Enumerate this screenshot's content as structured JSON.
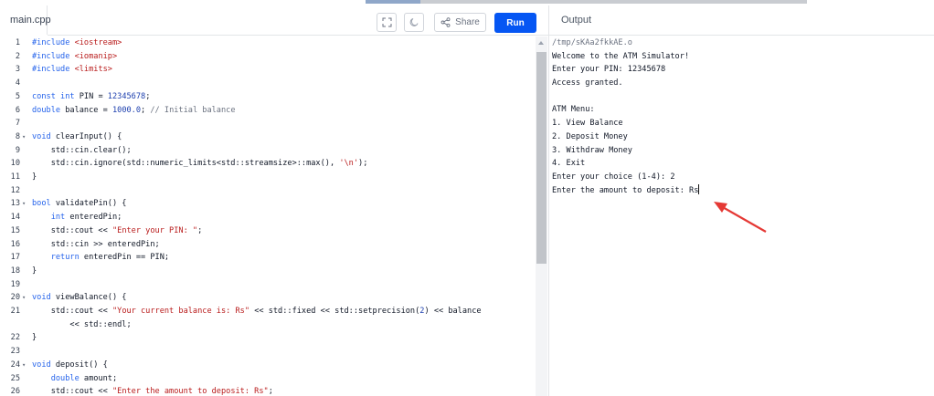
{
  "header": {
    "file_tab": "main.cpp",
    "share_label": "Share",
    "run_label": "Run",
    "output_label": "Output",
    "icons": [
      "fullscreen-icon",
      "theme-moon-icon",
      "share-icon"
    ]
  },
  "colors": {
    "run_button": "#0556f3",
    "keyword": "#2563eb",
    "string": "#b91c1c",
    "comment": "#6b7280",
    "annotation_arrow": "#e53935"
  },
  "editor": {
    "lines": [
      {
        "n": "1",
        "fold": "",
        "tokens": [
          {
            "t": "#include ",
            "c": "kw"
          },
          {
            "t": "<iostream>",
            "c": "inc"
          }
        ]
      },
      {
        "n": "2",
        "fold": "",
        "tokens": [
          {
            "t": "#include ",
            "c": "kw"
          },
          {
            "t": "<iomanip>",
            "c": "inc"
          }
        ]
      },
      {
        "n": "3",
        "fold": "",
        "tokens": [
          {
            "t": "#include ",
            "c": "kw"
          },
          {
            "t": "<limits>",
            "c": "inc"
          }
        ]
      },
      {
        "n": "4",
        "fold": "",
        "tokens": []
      },
      {
        "n": "5",
        "fold": "",
        "tokens": [
          {
            "t": "const int ",
            "c": "kw"
          },
          {
            "t": "PIN = ",
            "c": "pl"
          },
          {
            "t": "12345678",
            "c": "num"
          },
          {
            "t": ";",
            "c": "pl"
          }
        ]
      },
      {
        "n": "6",
        "fold": "",
        "tokens": [
          {
            "t": "double ",
            "c": "kw"
          },
          {
            "t": "balance = ",
            "c": "pl"
          },
          {
            "t": "1000.0",
            "c": "num"
          },
          {
            "t": "; ",
            "c": "pl"
          },
          {
            "t": "// Initial balance",
            "c": "cmt"
          }
        ]
      },
      {
        "n": "7",
        "fold": "",
        "tokens": []
      },
      {
        "n": "8",
        "fold": "▾",
        "tokens": [
          {
            "t": "void ",
            "c": "kw"
          },
          {
            "t": "clearInput() {",
            "c": "pl"
          }
        ]
      },
      {
        "n": "9",
        "fold": "",
        "tokens": [
          {
            "t": "    std::cin.clear();",
            "c": "pl"
          }
        ]
      },
      {
        "n": "10",
        "fold": "",
        "tokens": [
          {
            "t": "    std::cin.ignore(std::numeric_limits<std::streamsize>::max(), ",
            "c": "pl"
          },
          {
            "t": "'\\n'",
            "c": "str"
          },
          {
            "t": ");",
            "c": "pl"
          }
        ]
      },
      {
        "n": "11",
        "fold": "",
        "tokens": [
          {
            "t": "}",
            "c": "pl"
          }
        ]
      },
      {
        "n": "12",
        "fold": "",
        "tokens": []
      },
      {
        "n": "13",
        "fold": "▾",
        "tokens": [
          {
            "t": "bool ",
            "c": "kw"
          },
          {
            "t": "validatePin() {",
            "c": "pl"
          }
        ]
      },
      {
        "n": "14",
        "fold": "",
        "tokens": [
          {
            "t": "    ",
            "c": "pl"
          },
          {
            "t": "int ",
            "c": "kw"
          },
          {
            "t": "enteredPin;",
            "c": "pl"
          }
        ]
      },
      {
        "n": "15",
        "fold": "",
        "tokens": [
          {
            "t": "    std::cout << ",
            "c": "pl"
          },
          {
            "t": "\"Enter your PIN: \"",
            "c": "str"
          },
          {
            "t": ";",
            "c": "pl"
          }
        ]
      },
      {
        "n": "16",
        "fold": "",
        "tokens": [
          {
            "t": "    std::cin >> enteredPin;",
            "c": "pl"
          }
        ]
      },
      {
        "n": "17",
        "fold": "",
        "tokens": [
          {
            "t": "    ",
            "c": "pl"
          },
          {
            "t": "return ",
            "c": "kw"
          },
          {
            "t": "enteredPin == PIN;",
            "c": "pl"
          }
        ]
      },
      {
        "n": "18",
        "fold": "",
        "tokens": [
          {
            "t": "}",
            "c": "pl"
          }
        ]
      },
      {
        "n": "19",
        "fold": "",
        "tokens": []
      },
      {
        "n": "20",
        "fold": "▾",
        "tokens": [
          {
            "t": "void ",
            "c": "kw"
          },
          {
            "t": "viewBalance() {",
            "c": "pl"
          }
        ]
      },
      {
        "n": "21",
        "fold": "",
        "tokens": [
          {
            "t": "    std::cout << ",
            "c": "pl"
          },
          {
            "t": "\"Your current balance is: Rs\"",
            "c": "str"
          },
          {
            "t": " << std::fixed << std::setprecision(",
            "c": "pl"
          },
          {
            "t": "2",
            "c": "num"
          },
          {
            "t": ") << balance",
            "c": "pl"
          }
        ]
      },
      {
        "n": "",
        "fold": "",
        "tokens": [
          {
            "t": "        << std::endl;",
            "c": "pl"
          }
        ]
      },
      {
        "n": "22",
        "fold": "",
        "tokens": [
          {
            "t": "}",
            "c": "pl"
          }
        ]
      },
      {
        "n": "23",
        "fold": "",
        "tokens": []
      },
      {
        "n": "24",
        "fold": "▾",
        "tokens": [
          {
            "t": "void ",
            "c": "kw"
          },
          {
            "t": "deposit() {",
            "c": "pl"
          }
        ]
      },
      {
        "n": "25",
        "fold": "",
        "tokens": [
          {
            "t": "    ",
            "c": "pl"
          },
          {
            "t": "double ",
            "c": "kw"
          },
          {
            "t": "amount;",
            "c": "pl"
          }
        ]
      },
      {
        "n": "26",
        "fold": "",
        "tokens": [
          {
            "t": "    std::cout << ",
            "c": "pl"
          },
          {
            "t": "\"Enter the amount to deposit: Rs\"",
            "c": "str"
          },
          {
            "t": ";",
            "c": "pl"
          }
        ]
      }
    ]
  },
  "output": {
    "lines": [
      "/tmp/sKAa2fkkAE.o",
      "Welcome to the ATM Simulator!",
      "Enter your PIN: 12345678",
      "Access granted.",
      "",
      "ATM Menu:",
      "1. View Balance",
      "2. Deposit Money",
      "3. Withdraw Money",
      "4. Exit",
      "Enter your choice (1-4): 2",
      "Enter the amount to deposit: Rs"
    ]
  }
}
